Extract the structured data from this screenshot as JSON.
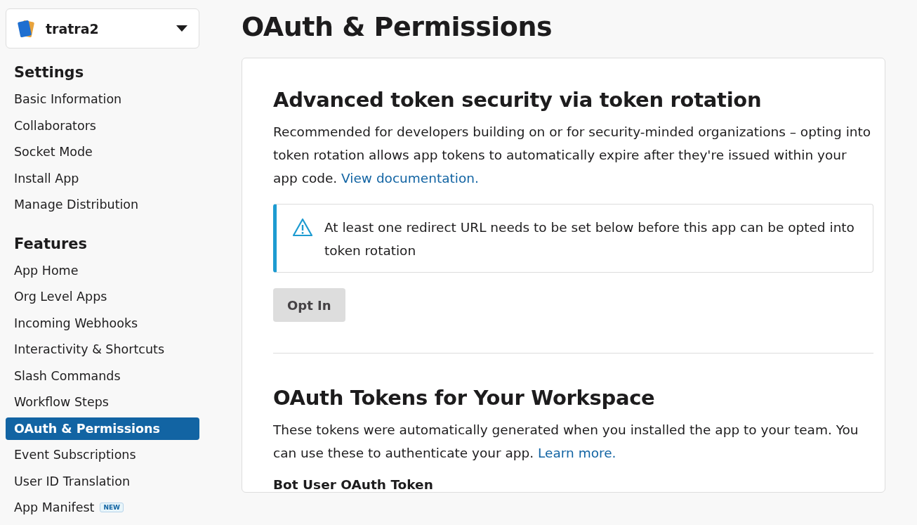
{
  "app_switcher": {
    "name": "tratra2"
  },
  "sidebar": {
    "sections": [
      {
        "title": "Settings",
        "items": [
          {
            "label": "Basic Information",
            "selected": false
          },
          {
            "label": "Collaborators",
            "selected": false
          },
          {
            "label": "Socket Mode",
            "selected": false
          },
          {
            "label": "Install App",
            "selected": false
          },
          {
            "label": "Manage Distribution",
            "selected": false
          }
        ]
      },
      {
        "title": "Features",
        "items": [
          {
            "label": "App Home",
            "selected": false
          },
          {
            "label": "Org Level Apps",
            "selected": false
          },
          {
            "label": "Incoming Webhooks",
            "selected": false
          },
          {
            "label": "Interactivity & Shortcuts",
            "selected": false
          },
          {
            "label": "Slash Commands",
            "selected": false
          },
          {
            "label": "Workflow Steps",
            "selected": false
          },
          {
            "label": "OAuth & Permissions",
            "selected": true
          },
          {
            "label": "Event Subscriptions",
            "selected": false
          },
          {
            "label": "User ID Translation",
            "selected": false
          },
          {
            "label": "App Manifest",
            "selected": false,
            "badge": "NEW"
          }
        ]
      }
    ]
  },
  "page_title": "OAuth & Permissions",
  "sections": [
    {
      "title": "Advanced token security via token rotation",
      "text": "Recommended for developers building on or for security-minded organizations – opting into token rotation allows app tokens to automatically expire after they're issued within your app code.",
      "link": "View documentation.",
      "alert": "At least one redirect URL needs to be set below before this app can be opted into token rotation",
      "button": {
        "label": "Opt In",
        "disabled": true
      }
    },
    {
      "title": "OAuth Tokens for Your Workspace",
      "text": "These tokens were automatically generated when you installed the app to your team. You can use these to authenticate your app.",
      "link": "Learn more.",
      "subheading": "Bot User OAuth Token"
    }
  ]
}
